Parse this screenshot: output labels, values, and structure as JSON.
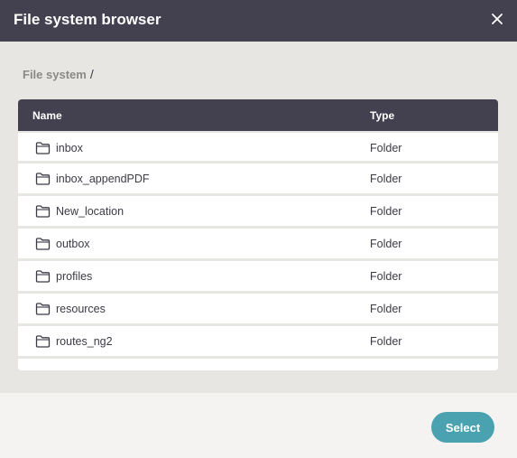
{
  "dialog": {
    "title": "File system browser",
    "close_icon": "close-icon"
  },
  "breadcrumb": {
    "root": "File system",
    "separator": "/"
  },
  "table": {
    "columns": {
      "name": "Name",
      "type": "Type"
    },
    "rows": [
      {
        "name": "inbox",
        "type": "Folder",
        "icon": "folder-icon"
      },
      {
        "name": "inbox_appendPDF",
        "type": "Folder",
        "icon": "folder-icon"
      },
      {
        "name": "New_location",
        "type": "Folder",
        "icon": "folder-icon"
      },
      {
        "name": "outbox",
        "type": "Folder",
        "icon": "folder-icon"
      },
      {
        "name": "profiles",
        "type": "Folder",
        "icon": "folder-icon"
      },
      {
        "name": "resources",
        "type": "Folder",
        "icon": "folder-icon"
      },
      {
        "name": "routes_ng2",
        "type": "Folder",
        "icon": "folder-icon"
      }
    ]
  },
  "footer": {
    "select_label": "Select"
  },
  "colors": {
    "header_bg": "#43404f",
    "body_bg": "#e8e6e3",
    "accent": "#4aa2b0"
  }
}
